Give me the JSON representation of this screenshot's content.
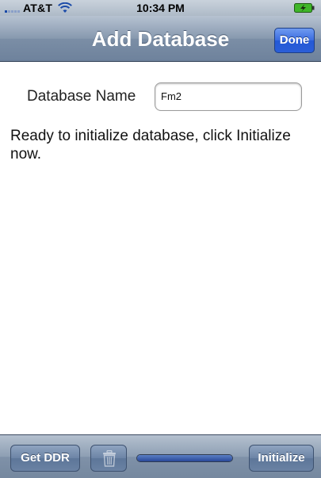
{
  "status_bar": {
    "carrier": "AT&T",
    "time": "10:34 PM",
    "signal_icon": "signal-bars-icon",
    "wifi_icon": "wifi-icon",
    "battery_icon": "battery-charging-icon"
  },
  "nav": {
    "title": "Add Database",
    "done_label": "Done"
  },
  "form": {
    "db_name_label": "Database Name",
    "db_name_value": "Fm2"
  },
  "message": "Ready to initialize database, click Initialize now.",
  "toolbar": {
    "get_ddr_label": "Get DDR",
    "trash_icon": "trash-icon",
    "initialize_label": "Initialize",
    "progress": 1.0
  },
  "colors": {
    "nav_gradient_top": "#b6c2d1",
    "nav_gradient_bottom": "#6e829c",
    "done_button_blue": "#2a5ed8",
    "toolbar_button": "#6a82a3",
    "progress_fill": "#28479a"
  }
}
